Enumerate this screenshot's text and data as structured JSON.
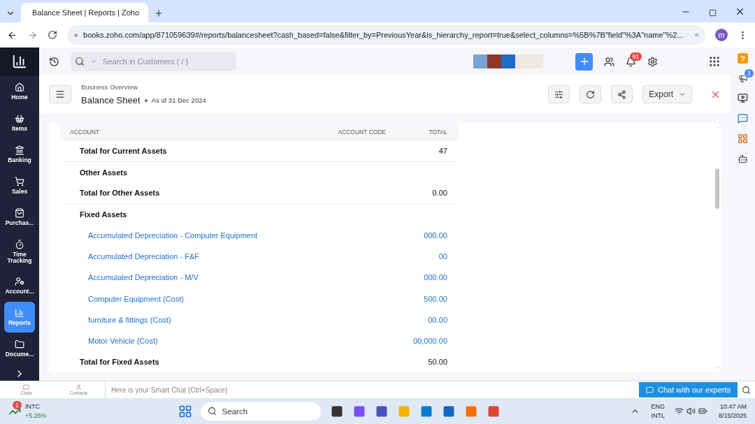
{
  "browser": {
    "tabs": [
      {
        "title": "Balance Sheet | Reports | Zoho",
        "selected": true
      }
    ],
    "url": "books.zoho.com/app/871059639#/reports/balancesheet?cash_based=false&filter_by=PreviousYear&is_hierarchy_report=true&select_columns=%5B%7B\"field\"%3A\"name\"%2...",
    "profile": "m"
  },
  "topbar": {
    "search_placeholder": "Search in Customers ( / )",
    "notification_count": "61"
  },
  "sidebar": {
    "items": [
      {
        "label": "Home",
        "selected": false
      },
      {
        "label": "Items",
        "selected": false
      },
      {
        "label": "Banking",
        "selected": false
      },
      {
        "label": "Sales",
        "selected": false
      },
      {
        "label": "Purchas...",
        "selected": false
      },
      {
        "label": "Time Tracking",
        "selected": false
      },
      {
        "label": "Account...",
        "selected": false
      },
      {
        "label": "Reports",
        "selected": true
      },
      {
        "label": "Docume...",
        "selected": false
      }
    ]
  },
  "header": {
    "breadcrumb": "Business Overview",
    "title": "Balance Sheet",
    "date": "As of 31 Dec 2024",
    "export": "Export"
  },
  "table": {
    "columns": [
      "ACCOUNT",
      "ACCOUNT CODE",
      "TOTAL"
    ],
    "rows": [
      {
        "kind": "total",
        "label": "Total for Current Assets",
        "value": "47"
      },
      {
        "kind": "group",
        "label": "Other Assets"
      },
      {
        "kind": "total",
        "label": "Total for Other Assets",
        "value": "0.00"
      },
      {
        "kind": "group",
        "label": "Fixed Assets"
      },
      {
        "kind": "account",
        "label": "Accumulated Depreciation - Computer Equipment",
        "value": "000.00"
      },
      {
        "kind": "account",
        "label": "Accumulated Depreciation - F&F",
        "value": "00"
      },
      {
        "kind": "account",
        "label": "Accumulated Depreciation - M/V",
        "value": "000.00"
      },
      {
        "kind": "account",
        "label": "Computer Equipment (Cost)",
        "value": "500.00"
      },
      {
        "kind": "account",
        "label": "furniture & fittings (Cost)",
        "value": "00.00"
      },
      {
        "kind": "account",
        "label": "Motor Vehicle (Cost)",
        "value": "00,000.00"
      },
      {
        "kind": "total",
        "label": "Total for Fixed Assets",
        "value": "50.00"
      }
    ]
  },
  "right_rail": {
    "help": "?",
    "updates_count": "3"
  },
  "smart_chat": {
    "chats": "Chats",
    "contacts": "Contacts",
    "placeholder": "Here is your Smart Chat (Ctrl+Space)",
    "button": "Chat with our experts"
  },
  "taskbar": {
    "stock_badge": "1",
    "stock": "INTC",
    "change": "+5.26%",
    "search": "Search",
    "lang": "ENG",
    "layout": "INTL",
    "time": "10:47 AM",
    "date": "8/15/2025"
  }
}
